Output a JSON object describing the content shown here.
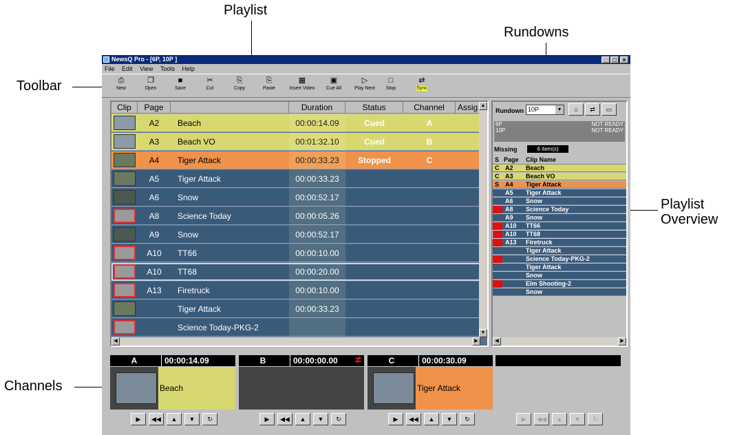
{
  "callouts": {
    "playlist": "Playlist",
    "rundowns": "Rundowns",
    "toolbar": "Toolbar",
    "playlist_overview_1": "Playlist",
    "playlist_overview_2": "Overview",
    "channels": "Channels"
  },
  "window": {
    "title": "NewsQ Pro - [6P, 10P ]",
    "min": "_",
    "max": "□",
    "close": "×"
  },
  "menu": [
    "File",
    "Edit",
    "View",
    "Tools",
    "Help"
  ],
  "toolbar": [
    {
      "label": "New",
      "icon": "⎙"
    },
    {
      "label": "Open",
      "icon": "❐"
    },
    {
      "label": "Save",
      "icon": "■"
    },
    {
      "label": "Cut",
      "icon": "✂"
    },
    {
      "label": "Copy",
      "icon": "⎘"
    },
    {
      "label": "Paste",
      "icon": "⎘"
    },
    {
      "label": "Insert Video",
      "icon": "▦"
    },
    {
      "label": "Cue All",
      "icon": "▣"
    },
    {
      "label": "Play Next",
      "icon": "▷"
    },
    {
      "label": "Stop",
      "icon": "□"
    },
    {
      "label": "Sync",
      "icon": "⇄"
    }
  ],
  "playlist": {
    "headers": [
      "Clip",
      "Page",
      "",
      "Duration",
      "Status",
      "Channel",
      "Assig"
    ],
    "rows": [
      {
        "page": "A2",
        "name": "Beach",
        "duration": "00:00:14.09",
        "status": "Cued",
        "channel": "A",
        "state": "cued"
      },
      {
        "page": "A3",
        "name": "Beach VO",
        "duration": "00:01:32.10",
        "status": "Cued",
        "channel": "B",
        "state": "cued"
      },
      {
        "page": "A4",
        "name": "Tiger Attack",
        "duration": "00:00:33.23",
        "status": "Stopped",
        "channel": "C",
        "state": "stopped"
      },
      {
        "page": "A5",
        "name": "Tiger Attack",
        "duration": "00:00:33.23",
        "status": "",
        "channel": "",
        "state": ""
      },
      {
        "page": "A6",
        "name": "Snow",
        "duration": "00:00:52.17",
        "status": "",
        "channel": "",
        "state": ""
      },
      {
        "page": "A8",
        "name": "Science Today",
        "duration": "00:00:05.26",
        "status": "",
        "channel": "",
        "state": ""
      },
      {
        "page": "A9",
        "name": "Snow",
        "duration": "00:00:52.17",
        "status": "",
        "channel": "",
        "state": ""
      },
      {
        "page": "A10",
        "name": "TT66",
        "duration": "00:00:10.00",
        "status": "",
        "channel": "",
        "state": ""
      },
      {
        "page": "A10",
        "name": "TT68",
        "duration": "00:00:20.00",
        "status": "",
        "channel": "",
        "state": "sel"
      },
      {
        "page": "A13",
        "name": "Firetruck",
        "duration": "00:00:10.00",
        "status": "",
        "channel": "",
        "state": ""
      },
      {
        "page": "",
        "name": "Tiger Attack",
        "duration": "00:00:33.23",
        "status": "",
        "channel": "",
        "state": ""
      },
      {
        "page": "",
        "name": "Science Today-PKG-2",
        "duration": "",
        "status": "",
        "channel": "",
        "state": ""
      }
    ]
  },
  "rundown": {
    "label": "Rundown",
    "selected": "10P",
    "list": [
      {
        "name": "6P",
        "status": "NOT READY"
      },
      {
        "name": "10P",
        "status": "NOT READY"
      }
    ],
    "missing_label": "Missing",
    "missing_count": "6 item(s)",
    "headers": [
      "S",
      "Page",
      "Clip Name"
    ],
    "rows": [
      {
        "s": "C",
        "page": "A2",
        "name": "Beach",
        "state": "cued",
        "red": false
      },
      {
        "s": "C",
        "page": "A3",
        "name": "Beach VO",
        "state": "cued",
        "red": false
      },
      {
        "s": "S",
        "page": "A4",
        "name": "Tiger Attack",
        "state": "stopped",
        "red": false
      },
      {
        "s": "",
        "page": "A5",
        "name": "Tiger Attack",
        "state": "",
        "red": false
      },
      {
        "s": "",
        "page": "A6",
        "name": "Snow",
        "state": "",
        "red": false
      },
      {
        "s": "",
        "page": "A8",
        "name": "Science Today",
        "state": "",
        "red": true
      },
      {
        "s": "",
        "page": "A9",
        "name": "Snow",
        "state": "",
        "red": false
      },
      {
        "s": "",
        "page": "A10",
        "name": "TT66",
        "state": "",
        "red": true
      },
      {
        "s": "",
        "page": "A10",
        "name": "TT68",
        "state": "sel",
        "red": true
      },
      {
        "s": "",
        "page": "A13",
        "name": "Firetruck",
        "state": "",
        "red": true
      },
      {
        "s": "",
        "page": "",
        "name": "Tiger Attack",
        "state": "",
        "red": false
      },
      {
        "s": "",
        "page": "",
        "name": "Science Today-PKG-2",
        "state": "",
        "red": true
      },
      {
        "s": "",
        "page": "",
        "name": "Tiger Attack",
        "state": "",
        "red": false
      },
      {
        "s": "",
        "page": "",
        "name": "Snow",
        "state": "",
        "red": false
      },
      {
        "s": "",
        "page": "",
        "name": "Elm Shooting-2",
        "state": "",
        "red": true
      },
      {
        "s": "",
        "page": "",
        "name": "Snow",
        "state": "",
        "red": false
      }
    ]
  },
  "channels": [
    {
      "name": "A",
      "time": "00:00:14.09",
      "clip": "Beach",
      "color": "#d8d870",
      "active": true,
      "warn": ""
    },
    {
      "name": "B",
      "time": "00:00:00.00",
      "clip": "",
      "color": "#444444",
      "active": true,
      "warn": "≠"
    },
    {
      "name": "C",
      "time": "00:00:30.09",
      "clip": "Tiger Attack",
      "color": "#f0924a",
      "active": true,
      "warn": ""
    },
    {
      "name": "",
      "time": "",
      "clip": "",
      "color": "#c0c0c0",
      "active": false,
      "warn": ""
    }
  ],
  "channel_buttons": [
    "▶",
    "◀◀",
    "▲",
    "▼",
    "↻"
  ]
}
